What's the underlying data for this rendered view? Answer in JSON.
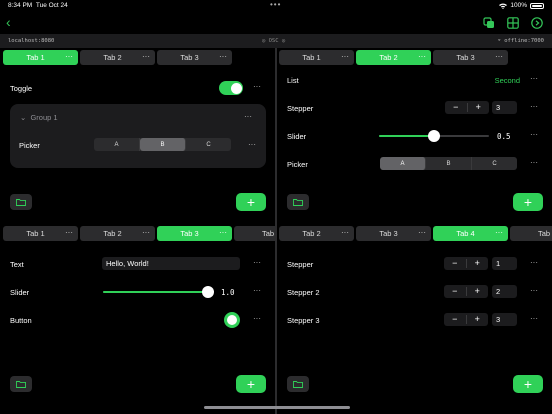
{
  "status": {
    "time": "8:34 PM",
    "date": "Tue Oct 24",
    "battery": "100%"
  },
  "connection": {
    "host": "localhost:8080",
    "osc": "OSC",
    "offline": "offline:7000"
  },
  "panes": {
    "top_left": {
      "tabs": [
        {
          "label": "Tab 1",
          "active": true
        },
        {
          "label": "Tab 2",
          "active": false
        },
        {
          "label": "Tab 3",
          "active": false
        }
      ],
      "toggle_label": "Toggle",
      "toggle_on": true,
      "group_title": "Group 1",
      "picker_label": "Picker",
      "picker_options": [
        "A",
        "B",
        "C"
      ],
      "picker_selected": "B"
    },
    "top_right": {
      "tabs": [
        {
          "label": "Tab 1",
          "active": false
        },
        {
          "label": "Tab 2",
          "active": true
        },
        {
          "label": "Tab 3",
          "active": false
        }
      ],
      "list_label": "List",
      "list_value": "Second",
      "stepper_label": "Stepper",
      "stepper_value": "3",
      "slider_label": "Slider",
      "slider_value": "0.5",
      "slider_fraction": 0.5,
      "picker_label": "Picker",
      "picker_options": [
        "A",
        "B",
        "C"
      ],
      "picker_selected": "A"
    },
    "bottom_left": {
      "tabs": [
        {
          "label": "Tab 1",
          "active": false
        },
        {
          "label": "Tab 2",
          "active": false
        },
        {
          "label": "Tab 3",
          "active": true
        },
        {
          "label": "Tab",
          "active": false
        }
      ],
      "text_label": "Text",
      "text_value": "Hello, World!",
      "slider_label": "Slider",
      "slider_value": "1.0",
      "slider_fraction": 1.0,
      "button_label": "Button"
    },
    "bottom_right": {
      "tabs": [
        {
          "label": "Tab 2",
          "active": false
        },
        {
          "label": "Tab 3",
          "active": false
        },
        {
          "label": "Tab 4",
          "active": true
        },
        {
          "label": "Tab",
          "active": false
        }
      ],
      "stepper1_label": "Stepper",
      "stepper1_value": "1",
      "stepper2_label": "Stepper 2",
      "stepper2_value": "2",
      "stepper3_label": "Stepper 3",
      "stepper3_value": "3"
    }
  },
  "common": {
    "more": "···",
    "minus": "−",
    "plus": "+",
    "add": "+"
  }
}
